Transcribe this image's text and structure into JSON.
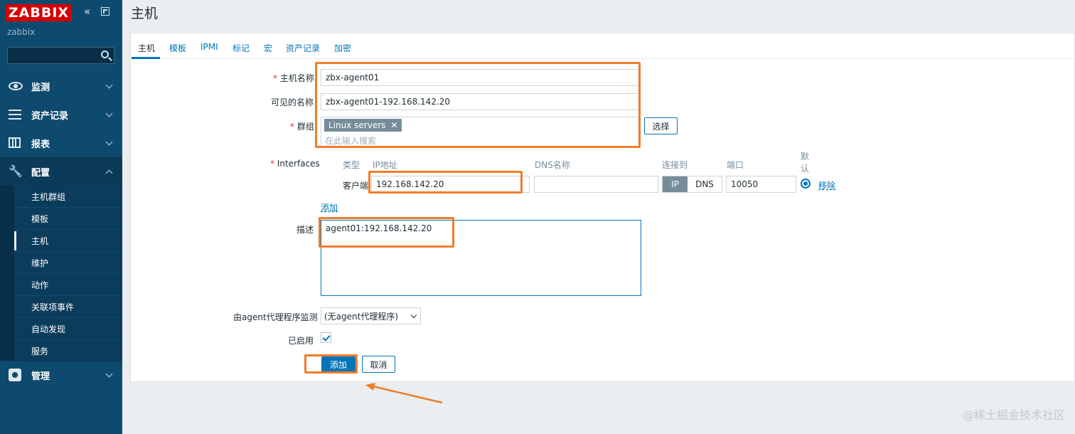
{
  "brand": {
    "logo_text": "ZABBIX",
    "server_name": "zabbix"
  },
  "sidebar": {
    "search_placeholder": "",
    "menus": [
      {
        "label": "监测",
        "icon": "eye-icon"
      },
      {
        "label": "资产记录",
        "icon": "list-icon"
      },
      {
        "label": "报表",
        "icon": "bar-chart-icon"
      },
      {
        "label": "配置",
        "icon": "wrench-icon",
        "expanded": true
      },
      {
        "label": "管理",
        "icon": "gear-icon"
      }
    ],
    "config_items": [
      "主机群组",
      "模板",
      "主机",
      "维护",
      "动作",
      "关联项事件",
      "自动发现",
      "服务"
    ],
    "active_config_item": "主机"
  },
  "page": {
    "title": "主机"
  },
  "tabs": [
    "主机",
    "模板",
    "IPMI",
    "标记",
    "宏",
    "资产记录",
    "加密"
  ],
  "active_tab": "主机",
  "form": {
    "host_name_label": "主机名称",
    "host_name_value": "zbx-agent01",
    "visible_name_label": "可见的名称",
    "visible_name_value": "zbx-agent01-192.168.142.20",
    "groups_label": "群组",
    "group_tag": "Linux servers",
    "groups_placeholder": "在此输入搜索",
    "select_button": "选择",
    "interfaces_label": "Interfaces",
    "col_type": "类型",
    "col_ip": "IP地址",
    "col_dns": "DNS名称",
    "col_connect": "连接到",
    "col_port": "端口",
    "col_default": "默认",
    "interface_type": "客户端",
    "ip_value": "192.168.142.20",
    "dns_value": "",
    "connect_ip": "IP",
    "connect_dns": "DNS",
    "port_value": "10050",
    "remove_link": "移除",
    "add_interface_link": "添加",
    "description_label": "描述",
    "description_value": "agent01:192.168.142.20",
    "proxy_label": "由agent代理程序监测",
    "proxy_value": "(无agent代理程序)",
    "enabled_label": "已启用",
    "enabled": true,
    "add_button": "添加",
    "cancel_button": "取消"
  },
  "watermark": "@稀土掘金技术社区",
  "colors": {
    "sidebar": "#0e4a6e",
    "accent": "#0275b8",
    "highlight": "#f07d2a",
    "logo": "#d40000"
  }
}
